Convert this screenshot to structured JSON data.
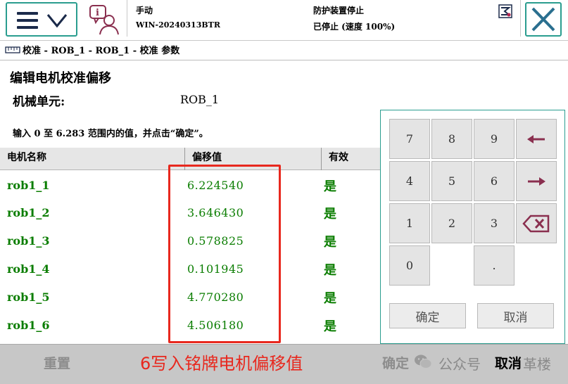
{
  "status": {
    "mode": "手动",
    "controller": "WIN-20240313BTR",
    "guard": "防护装置停止",
    "state": "已停止 (速度 100%)"
  },
  "breadcrumb": "校准 - ROB_1 - ROB_1 - 校准 参数",
  "header": {
    "title": "编辑电机校准偏移",
    "unit_label": "机械单元:",
    "unit_value": "ROB_1",
    "instruction": "输入 0 至 6.283 范围内的值，并点击“确定”。"
  },
  "table": {
    "columns": [
      "电机名称",
      "偏移值",
      "有效"
    ],
    "rows": [
      {
        "name": "rob1_1",
        "value": "6.224540",
        "valid": "是"
      },
      {
        "name": "rob1_2",
        "value": "3.646430",
        "valid": "是"
      },
      {
        "name": "rob1_3",
        "value": "0.578825",
        "valid": "是"
      },
      {
        "name": "rob1_4",
        "value": "0.101945",
        "valid": "是"
      },
      {
        "name": "rob1_5",
        "value": "4.770280",
        "valid": "是"
      },
      {
        "name": "rob1_6",
        "value": "4.506180",
        "valid": "是"
      }
    ]
  },
  "keypad": {
    "keys": [
      "7",
      "8",
      "9",
      "4",
      "5",
      "6",
      "1",
      "2",
      "3",
      "0",
      "."
    ],
    "ok": "确定",
    "cancel": "取消"
  },
  "bottom": {
    "reset": "重置",
    "ok": "确定",
    "cancel": "取消"
  },
  "annotation": "6写入铭牌电机偏移值",
  "watermark": {
    "text1": "公众号",
    "text2": "革楼"
  },
  "colors": {
    "accent": "#2a9d8f",
    "value_green": "#0a7d00",
    "annotation_red": "#e8281e"
  }
}
